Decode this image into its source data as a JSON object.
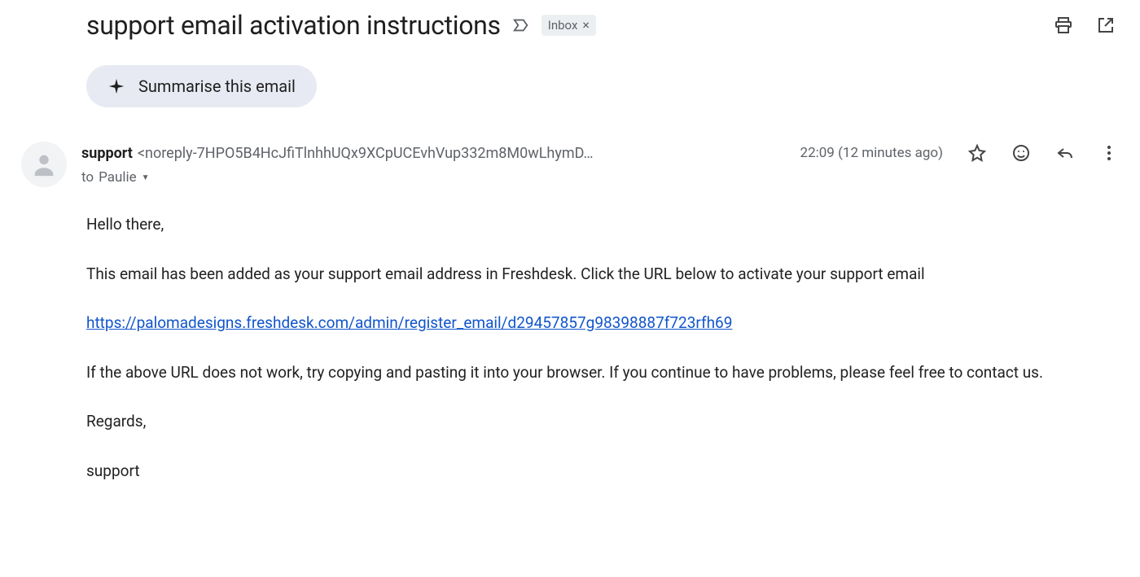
{
  "subject": "support email activation instructions",
  "label": "Inbox",
  "summarise_label": "Summarise this email",
  "sender": {
    "name": "support",
    "address_display": "<noreply-7HPO5B4HcJfiTlnhhUQx9XCpUCEvhVup332m8M0wLhymD…",
    "to_prefix": "to",
    "to_name": "Paulie"
  },
  "timestamp": "22:09 (12 minutes ago)",
  "body": {
    "greeting": "Hello there,",
    "p1": "This email has been added as your support email address in Freshdesk. Click the URL below to activate your support email",
    "link": "https://palomadesigns.freshdesk.com/admin/register_email/d29457857g98398887f723rfh69",
    "p2": "If the above URL does not work, try copying and pasting it into your browser. If you continue to have problems, please feel free to contact us.",
    "signoff": "Regards,",
    "signature": "support"
  }
}
